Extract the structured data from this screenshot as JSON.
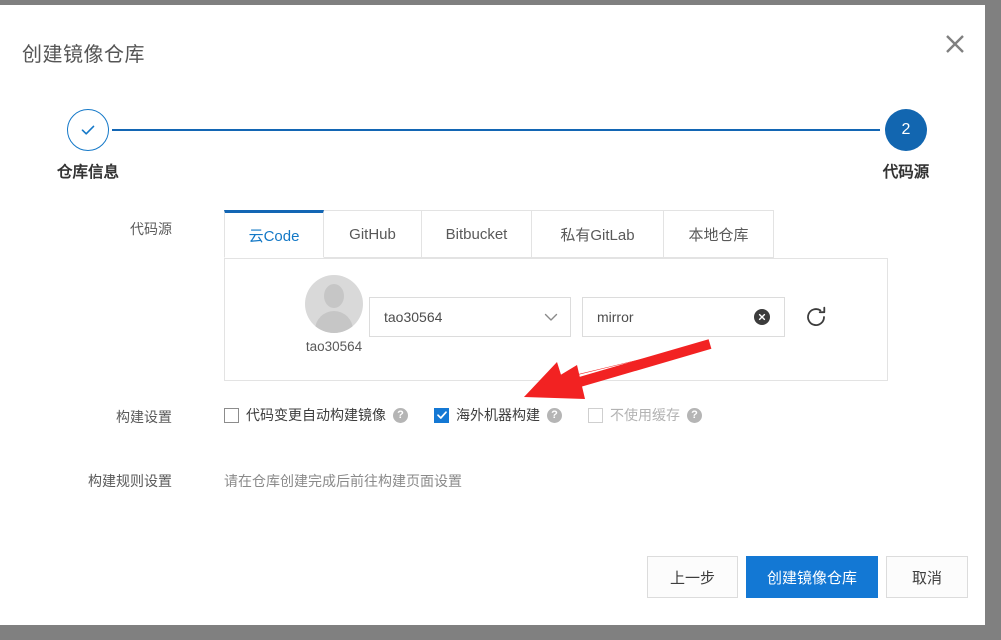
{
  "dialog": {
    "title": "创建镜像仓库",
    "close_icon": "close-icon"
  },
  "stepper": {
    "steps": [
      {
        "label": "仓库信息",
        "state": "done",
        "indicator": "✓"
      },
      {
        "label": "代码源",
        "state": "active",
        "indicator": "2"
      }
    ],
    "line_color": "#1366b4",
    "active_color": "#1266b0"
  },
  "form": {
    "source_label": "代码源",
    "build_settings_label": "构建设置",
    "build_rules_label": "构建规则设置",
    "build_rules_hint": "请在仓库创建完成后前往构建页面设置"
  },
  "tabs": [
    {
      "label": "云Code",
      "active": true
    },
    {
      "label": "GitHub",
      "active": false
    },
    {
      "label": "Bitbucket",
      "active": false
    },
    {
      "label": "私有GitLab",
      "active": false
    },
    {
      "label": "本地仓库",
      "active": false
    }
  ],
  "repo_panel": {
    "avatar_icon": "user-avatar-placeholder-icon",
    "avatar_name": "tao30564",
    "org_select": {
      "value": "tao30564",
      "icon": "chevron-down-icon"
    },
    "repo_input": {
      "value": "mirror",
      "placeholder": "",
      "clear_icon": "clear-circle-icon"
    },
    "refresh_icon": "refresh-icon"
  },
  "build_settings": {
    "checkboxes": [
      {
        "label": "代码变更自动构建镜像",
        "checked": false,
        "disabled": false,
        "help": "?"
      },
      {
        "label": "海外机器构建",
        "checked": true,
        "disabled": false,
        "help": "?"
      },
      {
        "label": "不使用缓存",
        "checked": false,
        "disabled": true,
        "help": "?"
      }
    ]
  },
  "footer": {
    "prev_label": "上一步",
    "create_label": "创建镜像仓库",
    "cancel_label": "取消",
    "primary_color": "#1378d4"
  },
  "annotation": {
    "type": "red-arrow",
    "color": "#f22222",
    "points_to": "海外机器构建"
  }
}
